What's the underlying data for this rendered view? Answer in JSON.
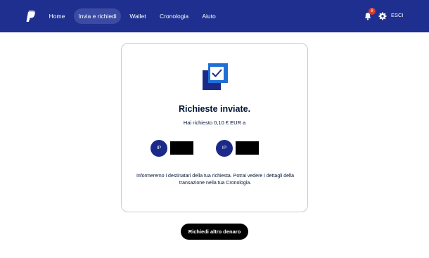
{
  "nav": {
    "items": [
      {
        "label": "Home"
      },
      {
        "label": "Invia e richiedi",
        "active": true
      },
      {
        "label": "Wallet"
      },
      {
        "label": "Cronologia"
      },
      {
        "label": "Aiuto"
      }
    ],
    "notifications_count": "8",
    "logout_label": "ESCI"
  },
  "icons": {
    "logo": "paypal-logo",
    "bell": "bell-icon",
    "settings": "gear-icon",
    "illustration": "checkbox-check-icon"
  },
  "colors": {
    "header_bg": "#1e2f8f",
    "active_nav_bg": "#3b4ba3",
    "badge": "#d93a2a",
    "avatar_bg": "#1b2a8a",
    "illustration_light": "#1f6fd6",
    "illustration_dark": "#1b2a8a",
    "button_bg": "#000000"
  },
  "confirmation": {
    "title": "Richieste inviate.",
    "subtitle": "Hai richiesto 0,10 € EUR a",
    "recipients": [
      {
        "initials": "IP"
      },
      {
        "initials": "IP"
      }
    ],
    "info": "Informeremo i destinatari della tua richiesta. Potrai vedere i dettagli della transazione nella tua Cronologia."
  },
  "cta": {
    "label": "Richiedi altro denaro"
  }
}
